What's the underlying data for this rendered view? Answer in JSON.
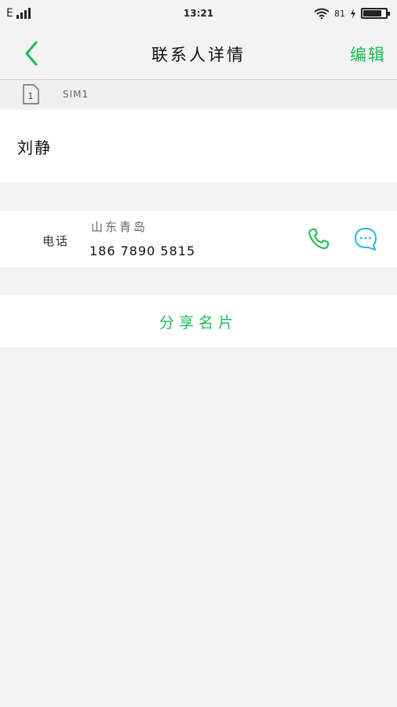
{
  "status_bar": {
    "network": "E",
    "time": "13:21",
    "battery_percent": "81",
    "battery_level": 0.81
  },
  "header": {
    "title": "联系人详情",
    "edit_label": "编辑",
    "back_icon": "chevron-left-icon"
  },
  "sim": {
    "label": "SIM1",
    "icon": "sim-card-icon"
  },
  "contact": {
    "name": "刘静"
  },
  "phone": {
    "type_label": "电话",
    "location": "山东青岛",
    "number": "186 7890 5815",
    "call_icon": "phone-icon",
    "message_icon": "message-bubble-icon"
  },
  "share": {
    "label": "分享名片"
  },
  "colors": {
    "accent_green": "#1ebc54",
    "message_cyan": "#29b6d8",
    "background": "#f3f3f3",
    "card": "#ffffff"
  }
}
